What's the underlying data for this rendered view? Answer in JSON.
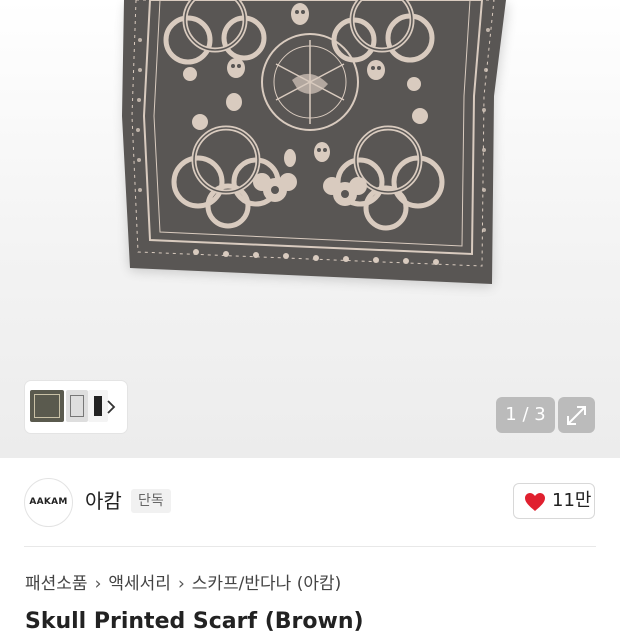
{
  "gallery": {
    "counter": "1 / 3",
    "colors": {
      "scarf": "#595654",
      "pattern": "#d9cbbf"
    }
  },
  "brand": {
    "logo_text": "AAKAM",
    "name": "아캄",
    "badge": "단독"
  },
  "like": {
    "count": "11만",
    "color": "#e0202f"
  },
  "breadcrumb": [
    "패션소품",
    "액세서리",
    "스카프/반다나 (아캄)"
  ],
  "product": {
    "title": "Skull Printed Scarf (Brown)"
  }
}
